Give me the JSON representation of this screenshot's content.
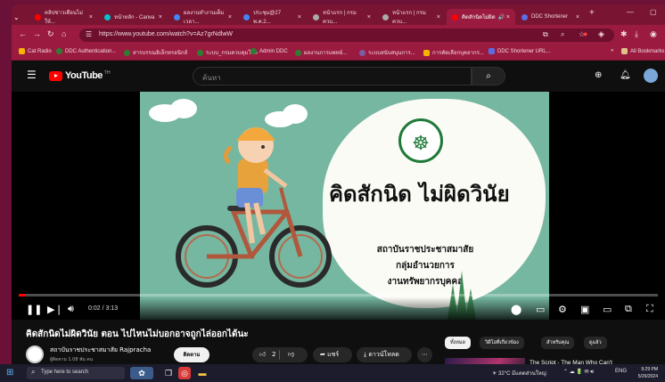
{
  "browser": {
    "tabs": [
      {
        "label": "คลิปข่าวเตือนไม่ให้...",
        "fav": "#ff0000"
      },
      {
        "label": "หน้าหลัก - Canva",
        "fav": "#00c4cc"
      },
      {
        "label": "ผลงานทำงานเต็มเวลา...",
        "fav": "#4285f4"
      },
      {
        "label": "ประชุม@27 พ.ค.2...",
        "fav": "#4285f4"
      },
      {
        "label": "หน้าแรก | กรมควบ...",
        "fav": "#aaaaaa"
      },
      {
        "label": "หน้าแรก | กรมควบ...",
        "fav": "#aaaaaa"
      },
      {
        "label": "คิดสักนิดไม่ผิด",
        "fav": "#ff0000"
      },
      {
        "label": "DDC Shortener",
        "fav": "#5b6ee1"
      }
    ],
    "new_tab": "+",
    "url": "https://www.youtube.com/watch?v=Az7grNdlwW",
    "bookmarks": [
      "Cat Radio",
      "DDC Authentication...",
      "สารบรรณอิเล็กทรอนิกส์",
      "ระบบ_กรมควบคุมโรค",
      "Admin DDC",
      "ผลงานการแพทย์...",
      "ระบบสนับสนุนการ...",
      "การคัดเลือกบุคลากร...",
      "DDC Shortener URL..."
    ],
    "all_bookmarks": "All Bookmarks"
  },
  "youtube": {
    "logo_text": "YouTube",
    "logo_suffix": "TH",
    "search_placeholder": "ค้นหา",
    "slide": {
      "title": "คิดสักนิด ไม่ผิดวินัย",
      "line1": "สถาบันราชประชาสมาสัย",
      "line2": "กลุ่มอำนวยการ",
      "line3": "งานทรัพยากรบุคคล"
    },
    "time": "0:02 / 3:13",
    "progress_fraction": 0.011,
    "video_title": "คิดสักนิดไม่ผิดวินัย ตอน ไปไหนไม่บอกอาจถูกไล่ออกได้นะ",
    "channel_name": "สถาบันราชประชาสมาสัย Rajpracha",
    "subscribers": "ผู้ติดตาม 1.08 พัน คน",
    "subscribe_label": "ติดตาม",
    "likes": "2",
    "share_label": "แชร์",
    "download_label": "ดาวน์โหลด",
    "chips": [
      "ทั้งหมด",
      "วิดีโอที่เกี่ยวข้อง",
      "สำหรับคุณ",
      "ดูแล้ว"
    ],
    "reco_title": "The Script - The Man Who Can't"
  },
  "taskbar": {
    "search_placeholder": "Type here to search",
    "weather": "32°C",
    "weather_desc": "มีแดดส่วนใหญ่",
    "lang": "ENG",
    "time": "9:29 PM",
    "date": "5/26/2024"
  }
}
